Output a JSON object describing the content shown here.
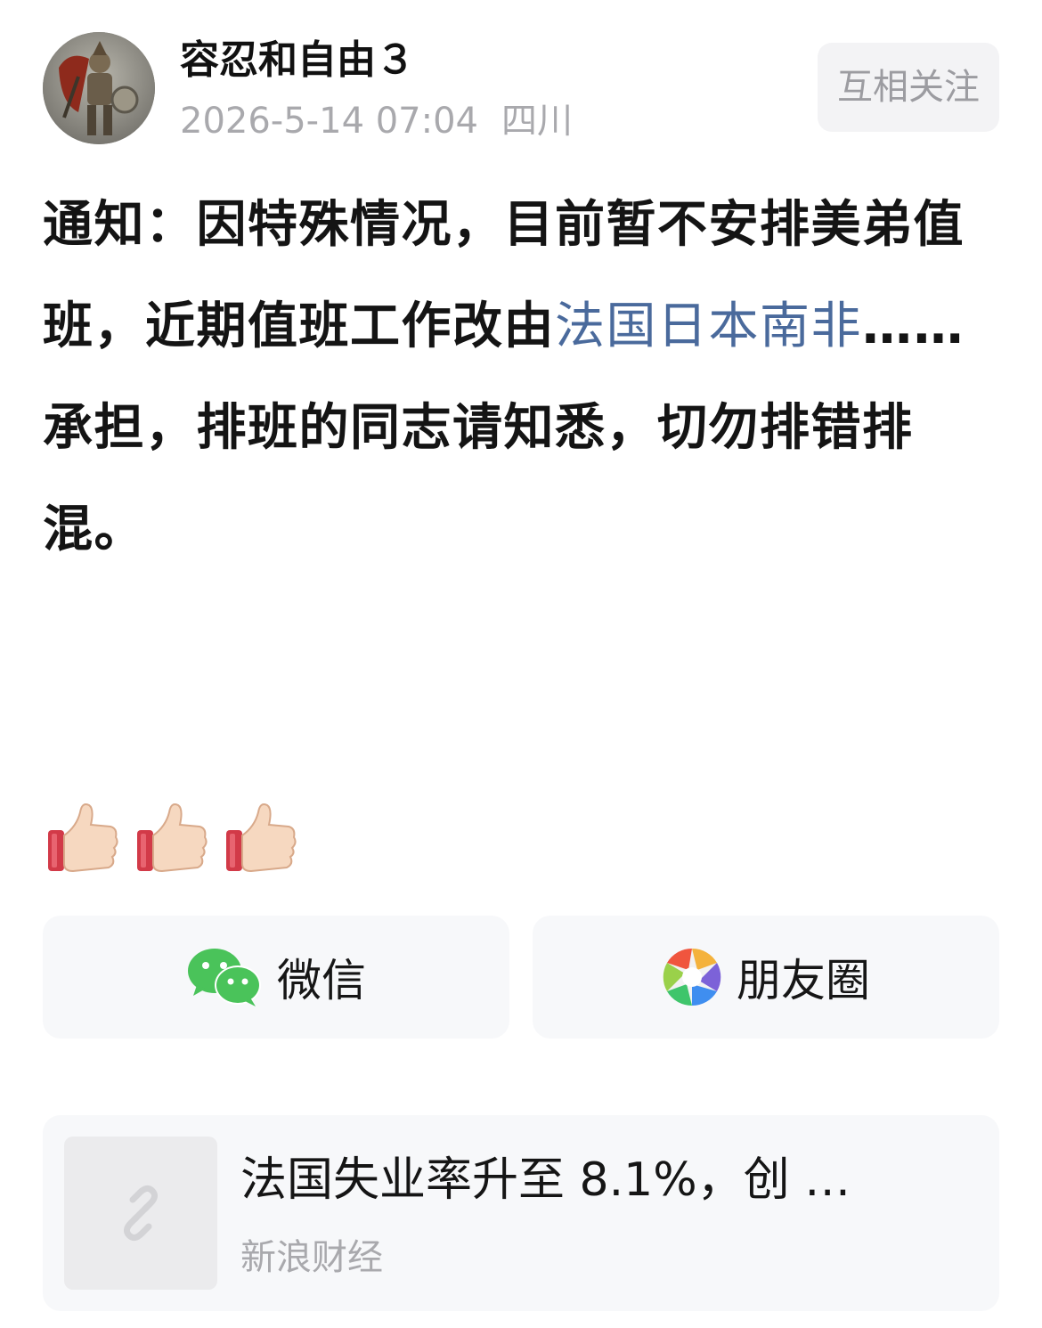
{
  "post": {
    "author": "容忍和自由３",
    "timestamp": "2026-5-14 07:04",
    "location": "四川",
    "follow_label": "互相关注",
    "text_before": "通知：因特殊情况，目前暂不安排美弟值班，近期值班工作改由",
    "text_link": "法国日本南非",
    "text_after": "……承担，排班的同志请知悉，切勿排错排混。",
    "reaction_emojis": [
      "thumbs-up",
      "thumbs-up",
      "thumbs-up"
    ]
  },
  "share": {
    "wechat_label": "微信",
    "moments_label": "朋友圈"
  },
  "link_card": {
    "title": "法国失业率升至 8.1%，创 …",
    "source": "新浪财经"
  },
  "colors": {
    "link": "#4a6a9c",
    "wechat_green": "#4ac35a",
    "muted": "#a9a9ad"
  }
}
